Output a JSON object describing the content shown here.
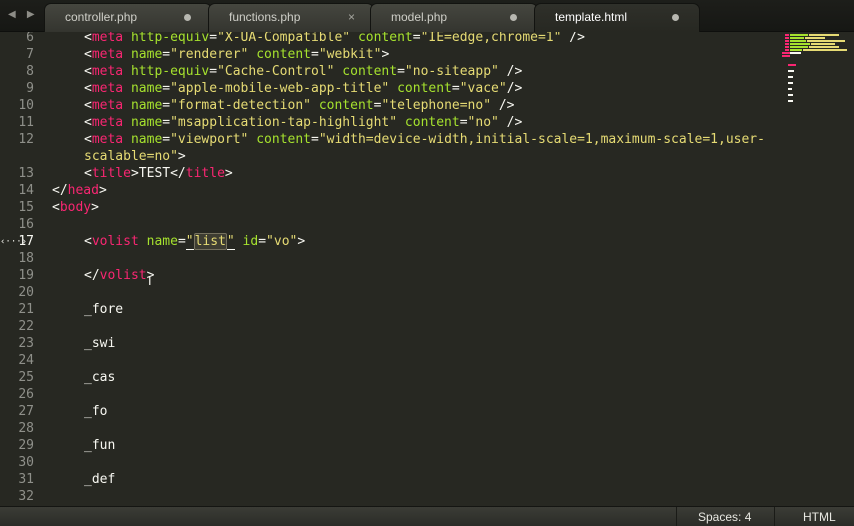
{
  "nav": {
    "back": "◀",
    "forward": "▶"
  },
  "tabs": [
    {
      "label": "controller.php",
      "modified": true
    },
    {
      "label": "functions.php",
      "close": "×"
    },
    {
      "label": "model.php",
      "modified": true
    },
    {
      "label": "template.html",
      "modified": true,
      "active": true
    }
  ],
  "gutter": [
    "6",
    "7",
    "8",
    "9",
    "10",
    "11",
    "12",
    "",
    "13",
    "14",
    "15",
    "16",
    "17",
    "18",
    "19",
    "20",
    "21",
    "22",
    "23",
    "24",
    "25",
    "26",
    "27",
    "28",
    "29",
    "30",
    "31",
    "32"
  ],
  "fold_marker": "‹···›",
  "code": {
    "l6": {
      "a": "<",
      "b": "meta",
      "c": " http-equiv",
      "d": "=",
      "e": "\"X-UA-Compatible\"",
      "f": " content",
      "g": "=",
      "h": "\"IE=edge,chrome=1\"",
      "i": " />"
    },
    "l7": {
      "a": "<",
      "b": "meta",
      "c": " name",
      "d": "=",
      "e": "\"renderer\"",
      "f": " content",
      "g": "=",
      "h": "\"webkit\"",
      "i": ">"
    },
    "l8": {
      "a": "<",
      "b": "meta",
      "c": " http-equiv",
      "d": "=",
      "e": "\"Cache-Control\"",
      "f": " content",
      "g": "=",
      "h": "\"no-siteapp\"",
      "i": " />"
    },
    "l9": {
      "a": "<",
      "b": "meta",
      "c": " name",
      "d": "=",
      "e": "\"apple-mobile-web-app-title\"",
      "f": " content",
      "g": "=",
      "h": "\"vace\"",
      "i": "/>"
    },
    "l10": {
      "a": "<",
      "b": "meta",
      "c": " name",
      "d": "=",
      "e": "\"format-detection\"",
      "f": " content",
      "g": "=",
      "h": "\"telephone=no\"",
      "i": " />"
    },
    "l11": {
      "a": "<",
      "b": "meta",
      "c": " name",
      "d": "=",
      "e": "\"msapplication-tap-highlight\"",
      "f": " content",
      "g": "=",
      "h": "\"no\"",
      "i": " />"
    },
    "l12": {
      "a": "<",
      "b": "meta",
      "c": " name",
      "d": "=",
      "e": "\"viewport\"",
      "f": " content",
      "g": "=",
      "h": "\"width=device-width,initial-scale=1,maximum-scale=1,user-"
    },
    "l12b": {
      "h": "scalable=no\"",
      "i": ">"
    },
    "l13": {
      "a": "<",
      "b": "title",
      "c": ">",
      "d": "TEST",
      "e": "</",
      "f": "title",
      "g": ">"
    },
    "l14": {
      "a": "</",
      "b": "head",
      "c": ">"
    },
    "l15": {
      "a": "<",
      "b": "body",
      "c": ">"
    },
    "l17": {
      "a": "<",
      "b": "volist",
      "c": " name",
      "d": "=",
      "e1": "\"",
      "e2": "list",
      "e3": "\"",
      "f": " id",
      "g": "=",
      "h": "\"vo\"",
      "i": ">"
    },
    "l19": {
      "a": "</",
      "b": "volist",
      "c": ">"
    },
    "l21": "_fore",
    "l23": "_swi",
    "l25": "_cas",
    "l27": "_fo",
    "l29": "_fun",
    "l31": "_def"
  },
  "status": {
    "spaces": "Spaces: 4",
    "syntax": "HTML"
  },
  "theme": {
    "background": "#272822",
    "tag": "#f92672",
    "attribute": "#a6e22e",
    "string": "#e6db74",
    "text": "#f8f8f2"
  }
}
